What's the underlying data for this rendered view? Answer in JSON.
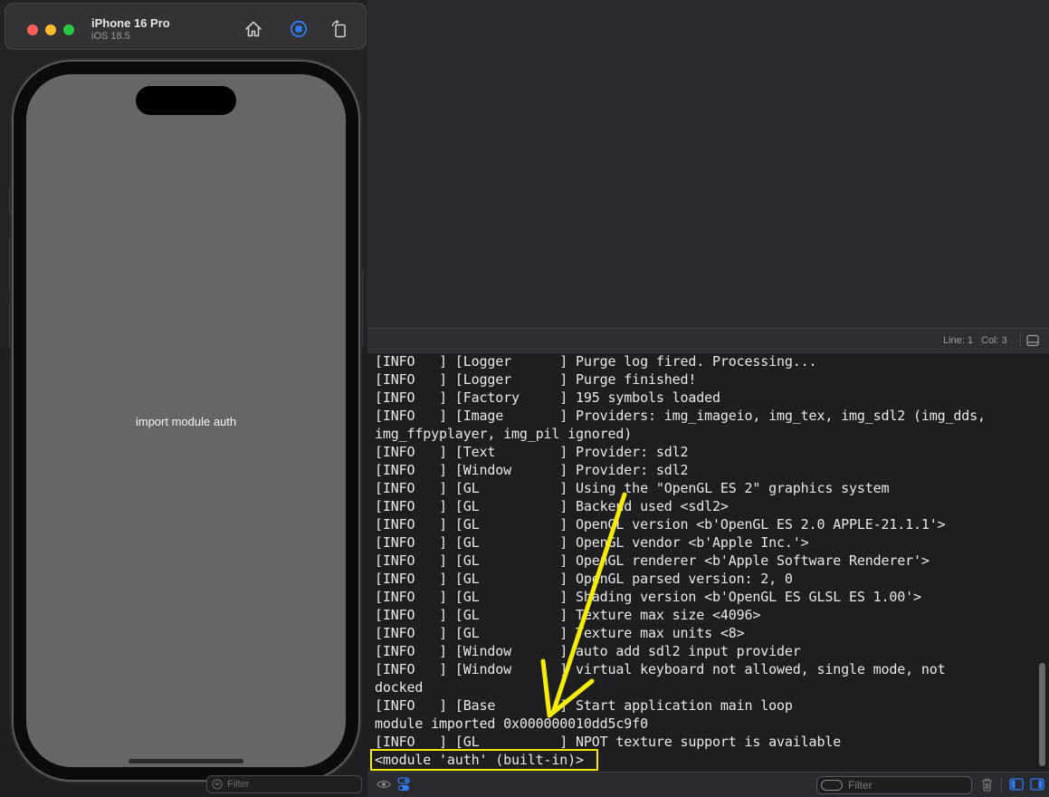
{
  "simulator": {
    "device_name": "iPhone 16 Pro",
    "os_version": "iOS 18.5",
    "toolbar_icons": [
      "home-icon",
      "stop-recording-icon",
      "rotate-icon"
    ],
    "screen_text": "import module auth",
    "screen_color": "#666666",
    "left_filter_placeholder": "Filter"
  },
  "status_bar": {
    "line": "Line: 1",
    "col": "Col: 3"
  },
  "console": {
    "lines": [
      "[INFO   ] [Logger      ] Purge log fired. Processing...",
      "[INFO   ] [Logger      ] Purge finished!",
      "[INFO   ] [Factory     ] 195 symbols loaded",
      "[INFO   ] [Image       ] Providers: img_imageio, img_tex, img_sdl2 (img_dds,",
      "img_ffpyplayer, img_pil ignored)",
      "[INFO   ] [Text        ] Provider: sdl2",
      "[INFO   ] [Window      ] Provider: sdl2",
      "[INFO   ] [GL          ] Using the \"OpenGL ES 2\" graphics system",
      "[INFO   ] [GL          ] Backend used <sdl2>",
      "[INFO   ] [GL          ] OpenGL version <b'OpenGL ES 2.0 APPLE-21.1.1'>",
      "[INFO   ] [GL          ] OpenGL vendor <b'Apple Inc.'>",
      "[INFO   ] [GL          ] OpenGL renderer <b'Apple Software Renderer'>",
      "[INFO   ] [GL          ] OpenGL parsed version: 2, 0",
      "[INFO   ] [GL          ] Shading version <b'OpenGL ES GLSL ES 1.00'>",
      "[INFO   ] [GL          ] Texture max size <4096>",
      "[INFO   ] [GL          ] Texture max units <8>",
      "[INFO   ] [Window      ] auto add sdl2 input provider",
      "[INFO   ] [Window      ] virtual keyboard not allowed, single mode, not",
      "docked",
      "[INFO   ] [Base        ] Start application main loop",
      "module imported 0x000000010dd5c9f0",
      "[INFO   ] [GL          ] NPOT texture support is available",
      "<module 'auth' (built-in)>"
    ],
    "highlight_color": "#f5ec0a",
    "filter_placeholder": "Filter"
  }
}
